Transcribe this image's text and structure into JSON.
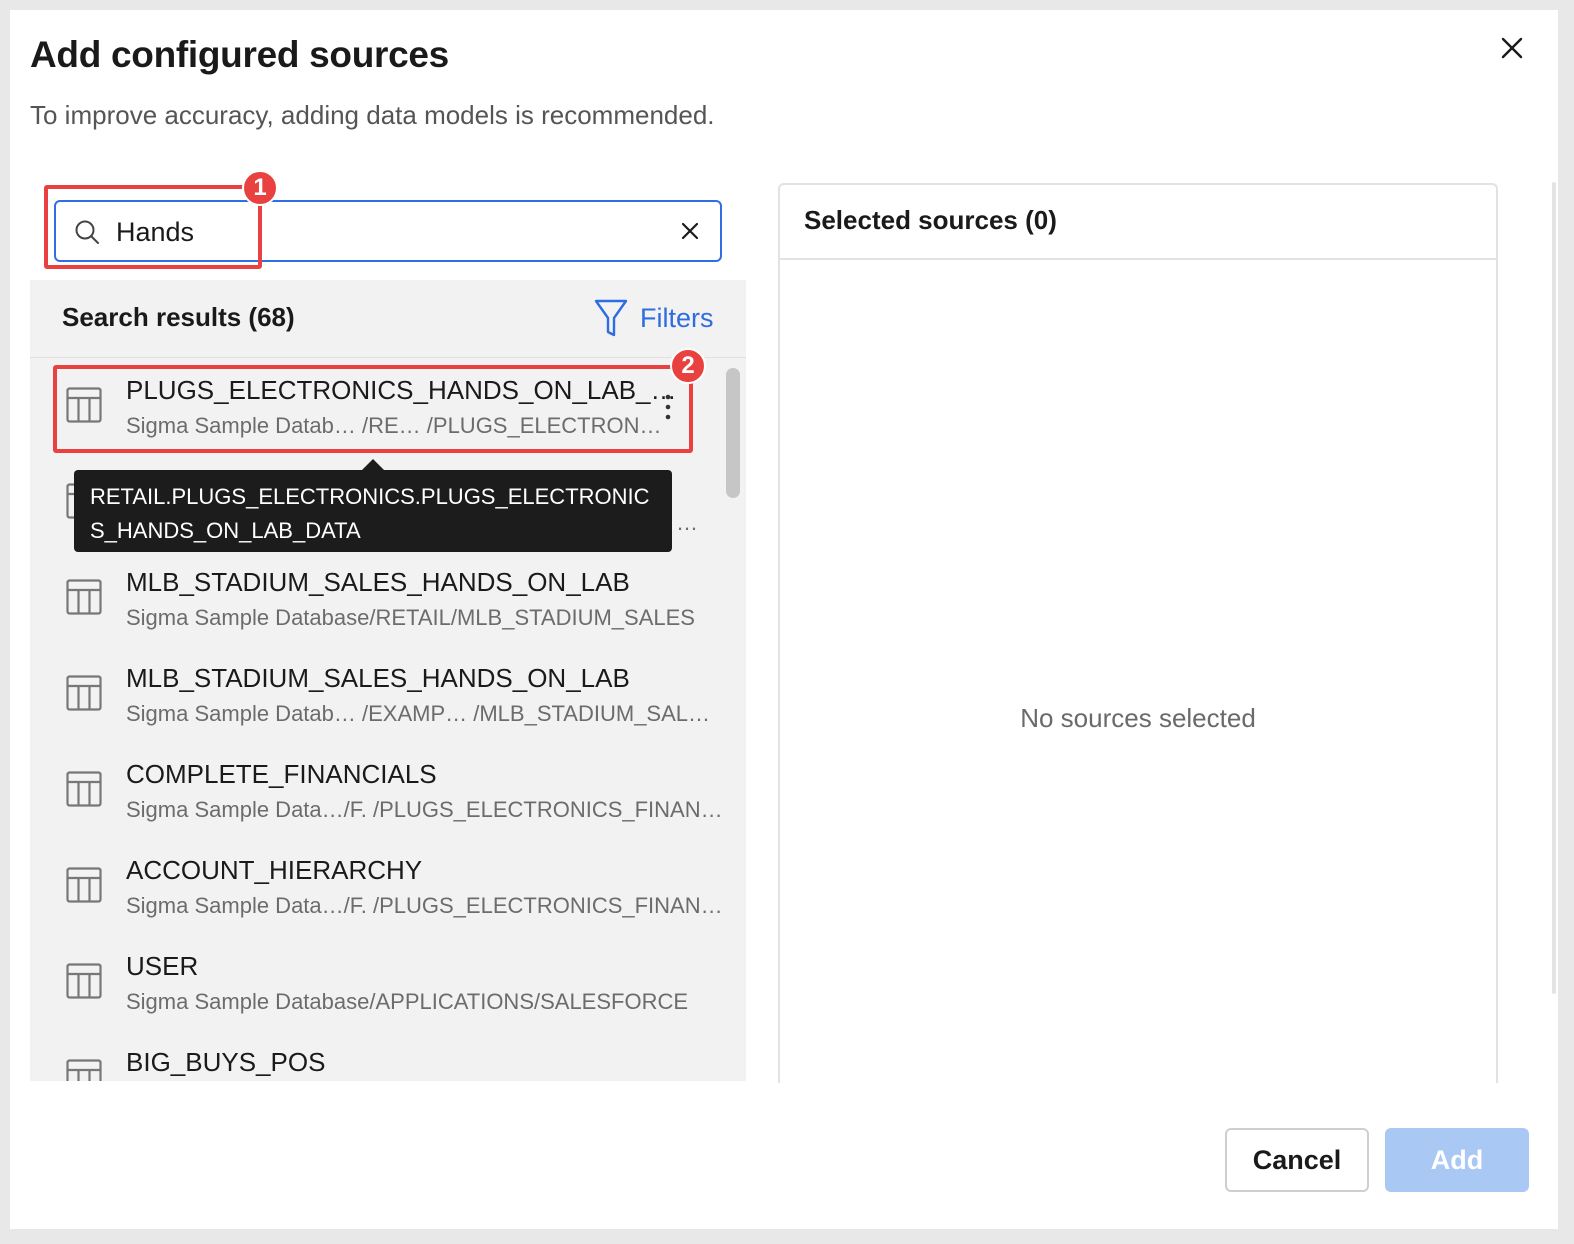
{
  "dialog": {
    "title": "Add configured sources",
    "subtitle": "To improve accuracy, adding data models is recommended."
  },
  "search": {
    "value": "Hands",
    "placeholder": ""
  },
  "results": {
    "title": "Search results (68)",
    "filters_label": "Filters",
    "items": [
      {
        "title": "PLUGS_ELECTRONICS_HANDS_ON_LAB_…",
        "path": "Sigma Sample Datab… /RE… /PLUGS_ELECTRON…"
      },
      {
        "title": "",
        "path": ""
      },
      {
        "title": "MLB_STADIUM_SALES_HANDS_ON_LAB",
        "path": "Sigma Sample Database/RETAIL/MLB_STADIUM_SALES"
      },
      {
        "title": "MLB_STADIUM_SALES_HANDS_ON_LAB",
        "path": "Sigma Sample Datab… /EXAMP… /MLB_STADIUM_SAL…"
      },
      {
        "title": "COMPLETE_FINANCIALS",
        "path": "Sigma Sample Data…/F. /PLUGS_ELECTRONICS_FINAN…"
      },
      {
        "title": "ACCOUNT_HIERARCHY",
        "path": "Sigma Sample Data…/F. /PLUGS_ELECTRONICS_FINAN…"
      },
      {
        "title": "USER",
        "path": "Sigma Sample Database/APPLICATIONS/SALESFORCE"
      },
      {
        "title": "BIG_BUYS_POS",
        "path": ""
      }
    ]
  },
  "tooltip": {
    "text": "RETAIL.PLUGS_ELECTRONICS.PLUGS_ELECTRONICS_HANDS_ON_LAB_DATA",
    "hidden_row_ellipsis": "…"
  },
  "selected": {
    "title": "Selected sources (0)",
    "empty_text": "No sources selected"
  },
  "footer": {
    "cancel_label": "Cancel",
    "add_label": "Add"
  },
  "annotations": {
    "badge1": "1",
    "badge2": "2",
    "color": "#e8413f"
  },
  "colors": {
    "accent": "#2f6fe4",
    "add_disabled": "#a9c8f3"
  },
  "icons": {
    "close": "close-icon",
    "search": "search-icon",
    "clear": "clear-icon",
    "filter": "filter-icon",
    "table": "table-icon",
    "more": "more-vertical-icon"
  }
}
